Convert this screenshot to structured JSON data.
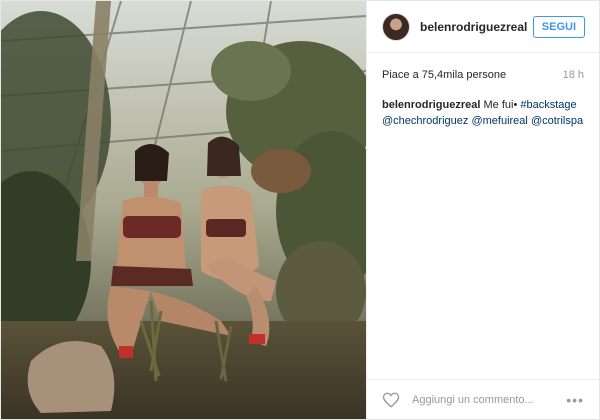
{
  "post": {
    "username": "belenrodriguezreal",
    "follow_label": "SEGUI",
    "likes": "Piace a 75,4mila persone",
    "time": "18 h",
    "caption": {
      "user": "belenrodriguezreal",
      "text": "Me fui•",
      "hashtag": "#backstage",
      "mentions": [
        "@chechrodriguez",
        "@mefuireal",
        "@cotrilspa"
      ]
    },
    "comment_placeholder": "Aggiungi un commento...",
    "more_label": "•••"
  }
}
